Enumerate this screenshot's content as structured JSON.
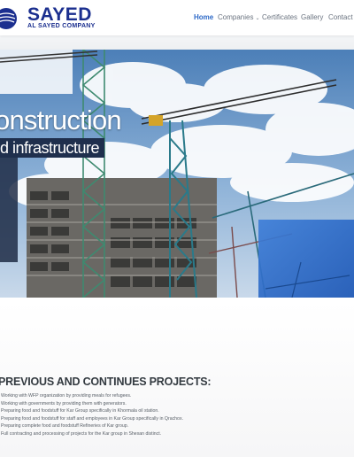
{
  "header": {
    "logo": {
      "name": "SAYED",
      "subtitle": "AL SAYED COMPANY",
      "brand_color": "#1b2f8f"
    },
    "nav": [
      {
        "label": "Home",
        "active": true,
        "has_dropdown": false
      },
      {
        "label": "Companies",
        "active": false,
        "has_dropdown": true
      },
      {
        "label": "Certificates",
        "active": false,
        "has_dropdown": false
      },
      {
        "label": "Gallery",
        "active": false,
        "has_dropdown": false
      },
      {
        "label": "Contact us",
        "active": false,
        "has_dropdown": false
      }
    ],
    "active_color": "#2d69c7"
  },
  "hero": {
    "title": "onstruction",
    "subtitle": "d infrastructure"
  },
  "projects": {
    "heading": "PREVIOUS AND CONTINUES PROJECTS:",
    "items": [
      "Working with WFP organization by providing meals for refugees.",
      "Working with governments by providing them with generators.",
      "Preparing food and foodstuff for Kar Group specifically in Khormala oil station.",
      "Preparing food and foodstuff for staff and employees in Kar Group specifically in Qrachox.",
      "Preparing complete food and foodstuff Refineries of Kar group.",
      "Full contracting and processing of projects for the Kar group in Shexan distinct."
    ]
  }
}
